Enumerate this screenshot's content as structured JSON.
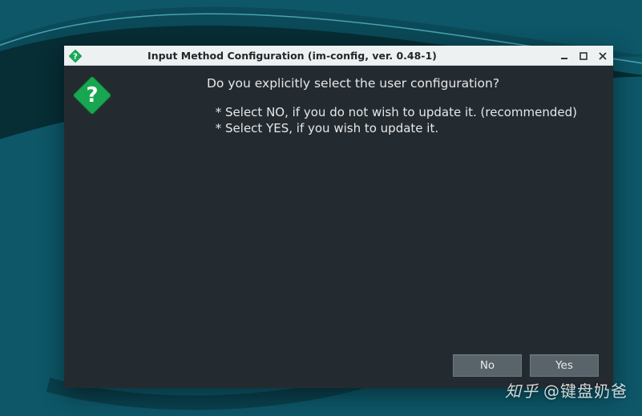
{
  "window": {
    "title": "Input Method Configuration (im-config, ver. 0.48-1)"
  },
  "dialog": {
    "question": "Do you explicitly select the user configuration?",
    "bullet1": " * Select NO, if you do not wish to update it. (recommended)",
    "bullet2": " * Select YES, if you wish to update it."
  },
  "buttons": {
    "no": "No",
    "yes": "Yes"
  },
  "watermark": {
    "text": "@键盘奶爸"
  }
}
